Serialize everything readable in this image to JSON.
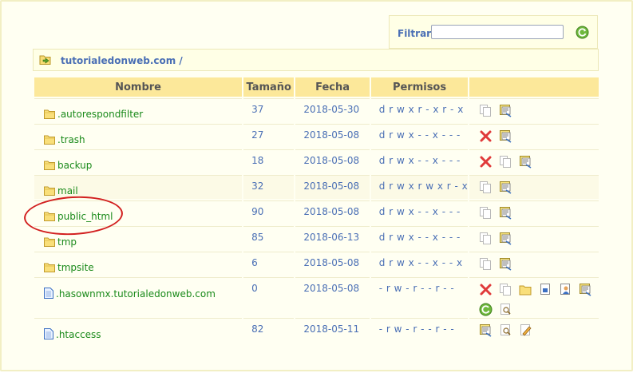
{
  "filter": {
    "label": "Filtrar:",
    "value": "",
    "placeholder": ""
  },
  "path": {
    "text": "tutorialedonweb.com /"
  },
  "table": {
    "headers": [
      "Nombre",
      "Tamaño",
      "Fecha",
      "Permisos",
      ""
    ],
    "rows": [
      {
        "name": ".autorespondfilter",
        "type": "folder",
        "size": "37",
        "date": "2018-05-30",
        "perms": "d r w x r - x r - x",
        "actions": [
          "copy",
          "rename"
        ]
      },
      {
        "name": ".trash",
        "type": "folder",
        "size": "27",
        "date": "2018-05-08",
        "perms": "d r w x - - x - - -",
        "actions": [
          "delete",
          "rename"
        ]
      },
      {
        "name": "backup",
        "type": "folder",
        "size": "18",
        "date": "2018-05-08",
        "perms": "d r w x - - x - - -",
        "actions": [
          "delete",
          "copy",
          "rename"
        ]
      },
      {
        "name": "mail",
        "type": "folder",
        "size": "32",
        "date": "2018-05-08",
        "perms": "d r w x r w x r - x",
        "actions": [
          "copy",
          "rename"
        ]
      },
      {
        "name": "public_html",
        "type": "folder",
        "size": "90",
        "date": "2018-05-08",
        "perms": "d r w x - - x - - -",
        "actions": [
          "copy",
          "rename"
        ]
      },
      {
        "name": "tmp",
        "type": "folder",
        "size": "85",
        "date": "2018-06-13",
        "perms": "d r w x - - x - - -",
        "actions": [
          "copy",
          "rename"
        ]
      },
      {
        "name": "tmpsite",
        "type": "folder",
        "size": "6",
        "date": "2018-05-08",
        "perms": "d r w x - - x - - x",
        "actions": [
          "copy",
          "rename"
        ]
      },
      {
        "name": ".hasownmx.tutorialedonweb.com",
        "type": "file",
        "size": "0",
        "date": "2018-05-08",
        "perms": "- r w - r - - r - -",
        "actions": [
          "delete",
          "copy",
          "move",
          "extract",
          "owner",
          "rename",
          "refresh",
          "view"
        ]
      },
      {
        "name": ".htaccess",
        "type": "file",
        "size": "82",
        "date": "2018-05-11",
        "perms": "- r w - r - - r - -",
        "actions": [
          "rename",
          "view",
          "edit"
        ]
      }
    ]
  },
  "colors": {
    "header_bg": "#fce89a",
    "link_green": "#1a8a1a",
    "text_blue": "#4a6fb5",
    "highlight_red": "#d22020"
  }
}
